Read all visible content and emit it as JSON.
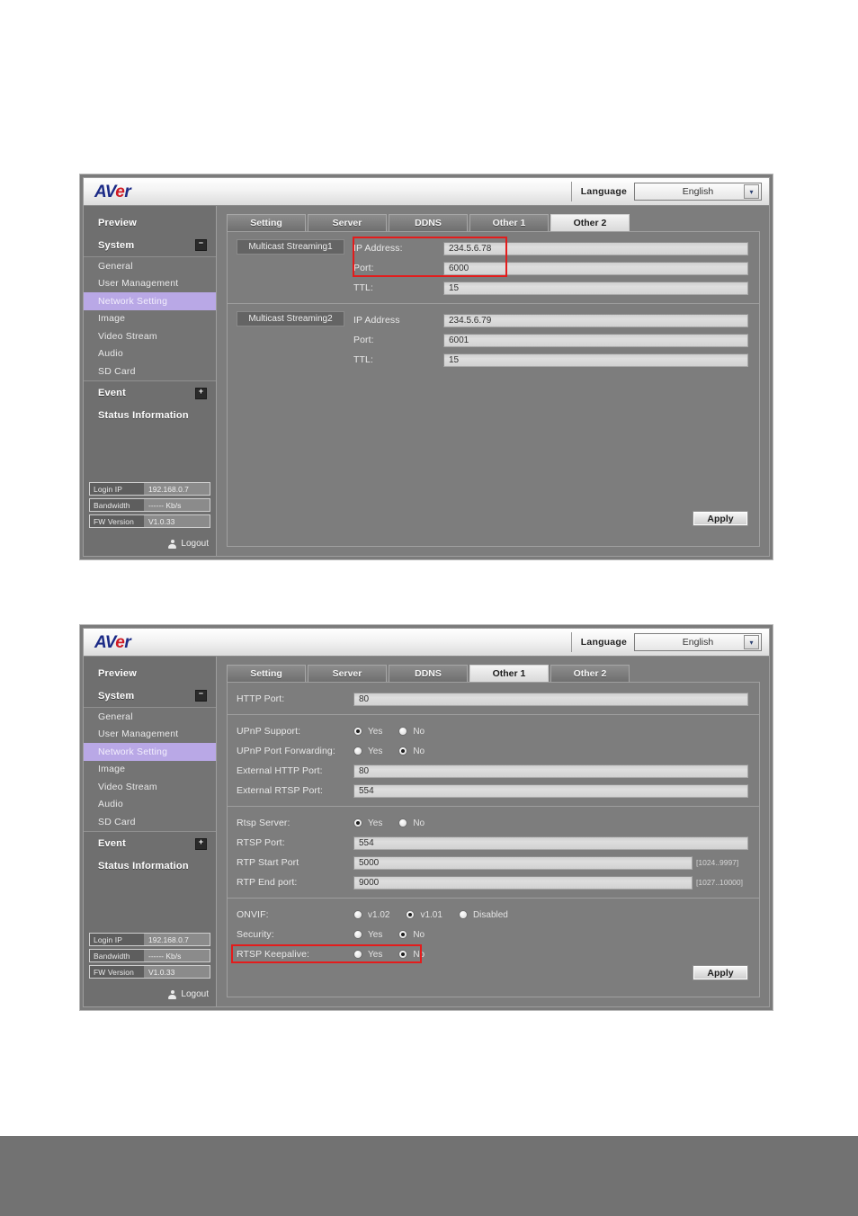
{
  "header": {
    "logo_av": "AV",
    "logo_e": "e",
    "logo_r": "r",
    "language_label": "Language",
    "language_value": "English",
    "dropdown_arrow": "▾"
  },
  "sidebar": {
    "preview": "Preview",
    "system": "System",
    "system_expander": "−",
    "items": [
      {
        "label": "General"
      },
      {
        "label": "User Management"
      },
      {
        "label": "Network Setting"
      },
      {
        "label": "Image"
      },
      {
        "label": "Video Stream"
      },
      {
        "label": "Audio"
      },
      {
        "label": "SD Card"
      }
    ],
    "event": "Event",
    "event_expander": "+",
    "status_information": "Status Information",
    "status": [
      {
        "key": "Login IP",
        "value": "192.168.0.7"
      },
      {
        "key": "Bandwidth",
        "value": "------ Kb/s"
      },
      {
        "key": "FW Version",
        "value": "V1.0.33"
      }
    ],
    "logout": "Logout"
  },
  "tabs": [
    "Setting",
    "Server",
    "DDNS",
    "Other 1",
    "Other 2"
  ],
  "panel1": {
    "active_tab": "Other 2",
    "groups": [
      {
        "badge": "Multicast Streaming1",
        "fields": [
          {
            "label": "IP Address:",
            "value": "234.5.6.78"
          },
          {
            "label": "Port:",
            "value": "6000"
          },
          {
            "label": "TTL:",
            "value": "15"
          }
        ]
      },
      {
        "badge": "Multicast Streaming2",
        "fields": [
          {
            "label": "IP Address",
            "value": "234.5.6.79"
          },
          {
            "label": "Port:",
            "value": "6001"
          },
          {
            "label": "TTL:",
            "value": "15"
          }
        ]
      }
    ],
    "apply_label": "Apply"
  },
  "panel2": {
    "active_tab": "Other 1",
    "http_port": {
      "label": "HTTP Port:",
      "value": "80"
    },
    "upnp_support": {
      "label": "UPnP Support:",
      "yes": "Yes",
      "no": "No",
      "selected": "Yes"
    },
    "upnp_forward": {
      "label": "UPnP Port Forwarding:",
      "yes": "Yes",
      "no": "No",
      "selected": "No"
    },
    "ext_http": {
      "label": "External HTTP Port:",
      "value": "80"
    },
    "ext_rtsp": {
      "label": "External RTSP Port:",
      "value": "554"
    },
    "rtsp_server": {
      "label": "Rtsp Server:",
      "yes": "Yes",
      "no": "No",
      "selected": "Yes"
    },
    "rtsp_port": {
      "label": "RTSP Port:",
      "value": "554"
    },
    "rtp_start": {
      "label": "RTP Start Port",
      "value": "5000",
      "hint": "[1024..9997]"
    },
    "rtp_end": {
      "label": "RTP End port:",
      "value": "9000",
      "hint": "[1027..10000]"
    },
    "onvif": {
      "label": "ONVIF:",
      "o1": "v1.02",
      "o2": "v1.01",
      "o3": "Disabled",
      "selected": "v1.01"
    },
    "security": {
      "label": "Security:",
      "yes": "Yes",
      "no": "No",
      "selected": "No"
    },
    "rtsp_keepalive": {
      "label": "RTSP Keepalive:",
      "yes": "Yes",
      "no": "No",
      "selected": "No"
    },
    "apply_label": "Apply"
  },
  "colors": {
    "accent_highlight": "#b9a8e6",
    "redbox": "#e31c1c",
    "logo_blue": "#1b2a86",
    "logo_red": "#cf1b25",
    "panel_bg": "#7d7d7d"
  }
}
